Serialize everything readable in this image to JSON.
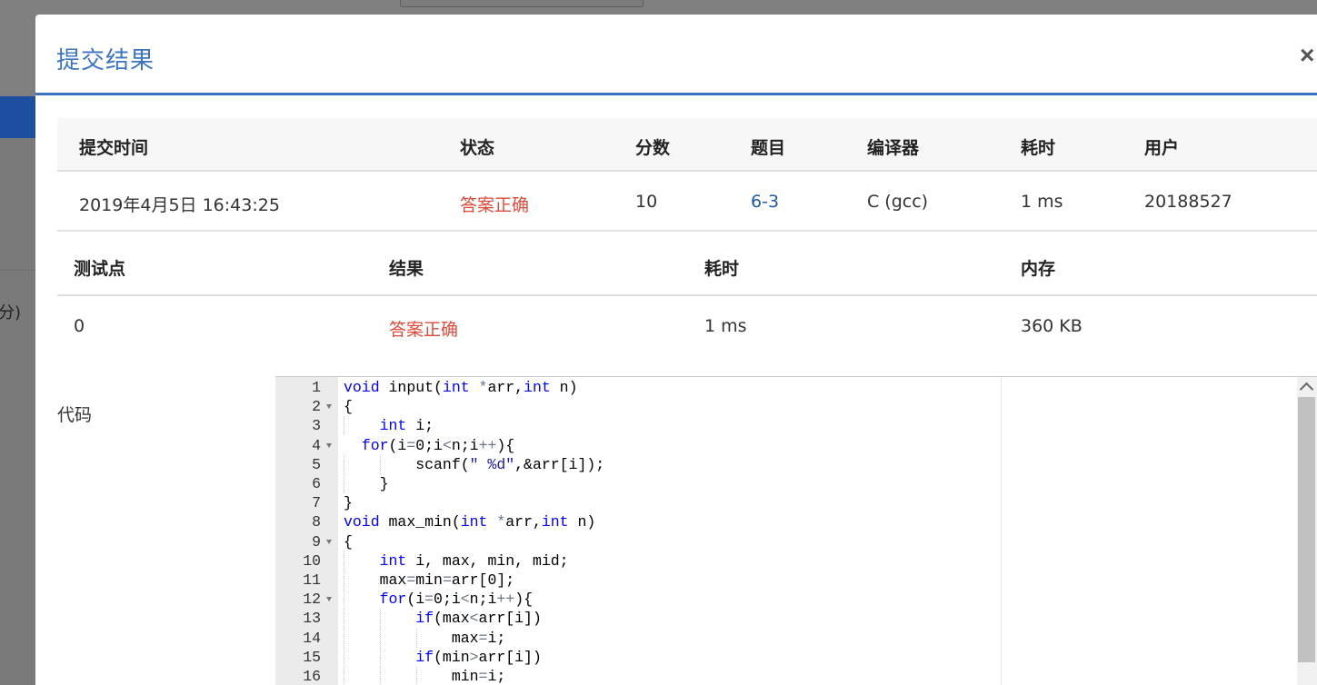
{
  "background": {
    "partial_text": "分)"
  },
  "modal": {
    "title": "提交结果",
    "close_label": "×"
  },
  "submission": {
    "headers": [
      "提交时间",
      "状态",
      "分数",
      "题目",
      "编译器",
      "耗时",
      "用户"
    ],
    "row": {
      "time": "2019年4月5日 16:43:25",
      "status": "答案正确",
      "score": "10",
      "problem": "6-3",
      "compiler": "C (gcc)",
      "elapsed": "1 ms",
      "user": "20188527"
    }
  },
  "tests": {
    "headers": [
      "测试点",
      "结果",
      "耗时",
      "内存"
    ],
    "row": {
      "case": "0",
      "result": "答案正确",
      "elapsed": "1 ms",
      "memory": "360 KB"
    }
  },
  "code": {
    "label": "代码",
    "lines": [
      {
        "n": "1",
        "text": "void input(int *arr,int n)"
      },
      {
        "n": "2",
        "text": "{"
      },
      {
        "n": "3",
        "text": "    int i;"
      },
      {
        "n": "4",
        "text": "  for(i=0;i<n;i++){"
      },
      {
        "n": "5",
        "text": "        scanf(\" %d\",&arr[i]);"
      },
      {
        "n": "6",
        "text": "    }"
      },
      {
        "n": "7",
        "text": "}"
      },
      {
        "n": "8",
        "text": "void max_min(int *arr,int n)"
      },
      {
        "n": "9",
        "text": "{"
      },
      {
        "n": "10",
        "text": "    int i, max, min, mid;"
      },
      {
        "n": "11",
        "text": "    max=min=arr[0];"
      },
      {
        "n": "12",
        "text": "    for(i=0;i<n;i++){"
      },
      {
        "n": "13",
        "text": "        if(max<arr[i])"
      },
      {
        "n": "14",
        "text": "            max=i;"
      },
      {
        "n": "15",
        "text": "        if(min>arr[i])"
      },
      {
        "n": "16",
        "text": "            min=i;"
      }
    ]
  },
  "colors": {
    "accent": "#3d74c2",
    "accepted": "#e04a3a",
    "keyword": "#0000ff"
  }
}
